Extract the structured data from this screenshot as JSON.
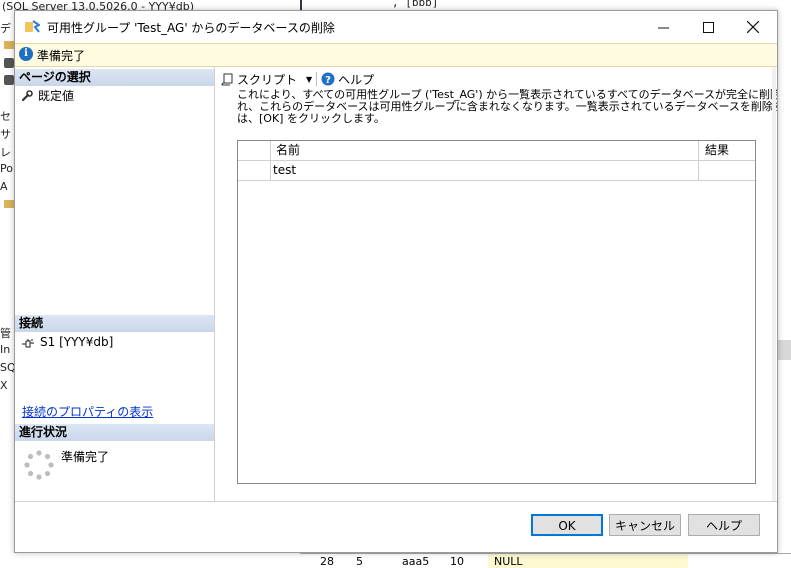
{
  "background": {
    "title": "(SQL Server 13.0.5026.0 - YYY¥db)",
    "code_text": ", [bbb]",
    "left_strip": [
      "デ",
      "セ",
      "サ",
      "レ",
      "Po",
      "A",
      "管",
      "In",
      "SQ",
      "X"
    ],
    "bottom_row": [
      "28",
      "5",
      "aaa5",
      "10",
      "NULL"
    ]
  },
  "dialog": {
    "title": "可用性グループ 'Test_AG' からのデータベースの削除",
    "status": "準備完了",
    "select_page": {
      "header": "ページの選択",
      "items": [
        {
          "label": "既定値",
          "icon": "wrench-icon"
        }
      ]
    },
    "connection": {
      "header": "接続",
      "server": "S1 [YYY¥db]",
      "view_properties_link": "接続のプロパティの表示"
    },
    "progress": {
      "header": "進行状況",
      "text": "準備完了"
    },
    "toolbar": {
      "script_label": "スクリプト",
      "help_label": "ヘルプ"
    },
    "description_lines": [
      "これにより、すべての可用性グループ ('Test_AG') から一覧表示されているすべてのデータベースが完全に削除さ",
      "れ、これらのデータベースは可用性グループに含まれなくなります。一覧表示されているデータベースを削除するに",
      "は、[OK] をクリックします。"
    ],
    "grid": {
      "columns": [
        "名前",
        "結果"
      ],
      "rows": [
        {
          "name": "test",
          "result": ""
        }
      ]
    },
    "buttons": {
      "ok": "OK",
      "cancel": "キャンセル",
      "help": "ヘルプ"
    }
  },
  "colors": {
    "status_bar_bg": "#fffbe0",
    "section_header": "#c9d7ea",
    "link": "#0033cc",
    "default_button_border": "#0078d7"
  }
}
